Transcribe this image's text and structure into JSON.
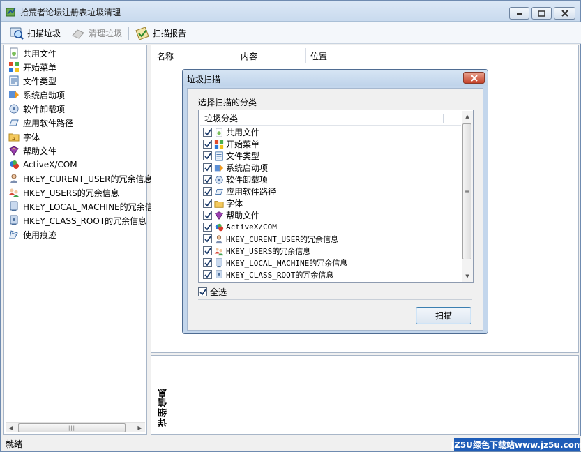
{
  "app": {
    "title": "拾荒者论坛注册表垃圾清理"
  },
  "toolbar": {
    "scan": "扫描垃圾",
    "clean": "清理垃圾",
    "report": "扫描报告"
  },
  "tree": {
    "items": [
      {
        "label": "共用文件",
        "icon": "shared-file-icon"
      },
      {
        "label": "开始菜单",
        "icon": "start-menu-icon"
      },
      {
        "label": "文件类型",
        "icon": "file-type-icon"
      },
      {
        "label": "系统启动项",
        "icon": "startup-icon"
      },
      {
        "label": "软件卸载项",
        "icon": "uninstall-icon"
      },
      {
        "label": "应用软件路径",
        "icon": "app-path-icon"
      },
      {
        "label": "字体",
        "icon": "font-folder-icon"
      },
      {
        "label": "帮助文件",
        "icon": "help-book-icon"
      },
      {
        "label": "ActiveX/COM",
        "icon": "activex-icon"
      },
      {
        "label": "HKEY_CURENT_USER的冗余信息",
        "icon": "user-icon"
      },
      {
        "label": "HKEY_USERS的冗余信息",
        "icon": "users-icon"
      },
      {
        "label": "HKEY_LOCAL_MACHINE的冗余信息",
        "icon": "machine-icon"
      },
      {
        "label": "HKEY_CLASS_ROOT的冗余信息",
        "icon": "class-root-icon"
      },
      {
        "label": "使用痕迹",
        "icon": "trace-icon"
      }
    ]
  },
  "results": {
    "columns": [
      "名称",
      "内容",
      "位置"
    ]
  },
  "details": {
    "label": "详细信息"
  },
  "status": {
    "text": "就绪"
  },
  "watermark": "JZ5U绿色下载站www.jz5u.com",
  "dialog": {
    "title": "垃圾扫描",
    "prompt": "选择扫描的分类",
    "list_header": "垃圾分类",
    "items": [
      {
        "label": "共用文件",
        "checked": true
      },
      {
        "label": "开始菜单",
        "checked": true
      },
      {
        "label": "文件类型",
        "checked": true
      },
      {
        "label": "系统启动项",
        "checked": true
      },
      {
        "label": "软件卸载项",
        "checked": true
      },
      {
        "label": "应用软件路径",
        "checked": true
      },
      {
        "label": "字体",
        "checked": true
      },
      {
        "label": "帮助文件",
        "checked": true
      },
      {
        "label": "ActiveX/COM",
        "checked": true
      },
      {
        "label": "HKEY_CURENT_USER的冗余信息",
        "checked": true
      },
      {
        "label": "HKEY_USERS的冗余信息",
        "checked": true
      },
      {
        "label": "HKEY_LOCAL_MACHINE的冗余信息",
        "checked": true
      },
      {
        "label": "HKEY_CLASS_ROOT的冗余信息",
        "checked": true
      }
    ],
    "select_all": "全选",
    "select_all_checked": true,
    "scan_button": "扫描"
  }
}
